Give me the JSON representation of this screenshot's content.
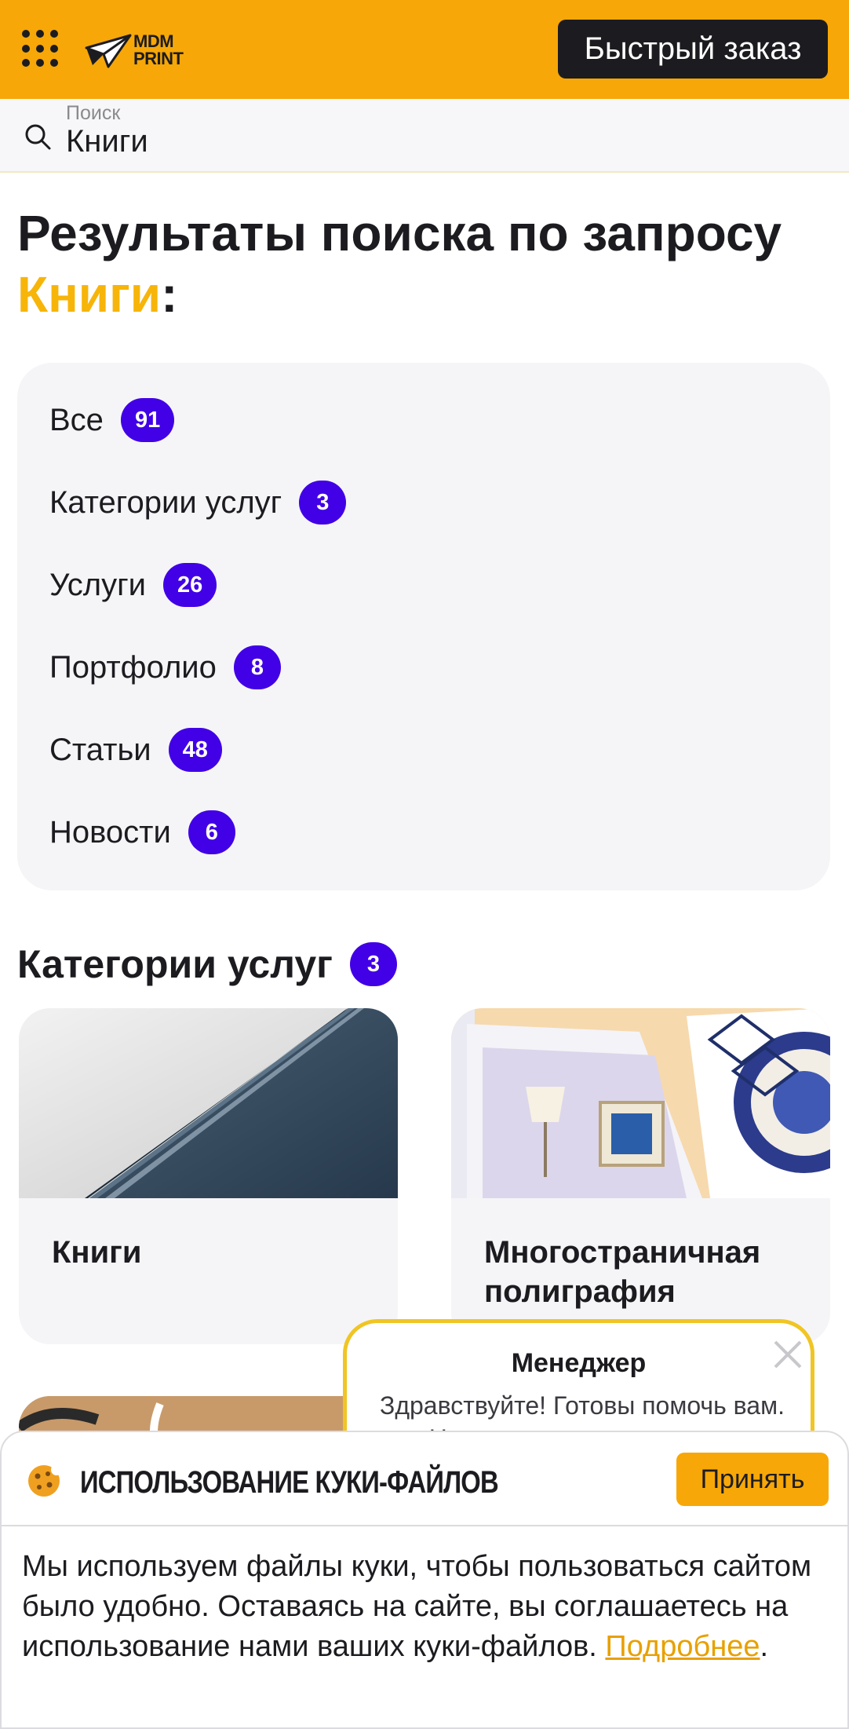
{
  "header": {
    "logo_text_1": "MDM",
    "logo_text_2": "PRINT",
    "quick_order_label": "Быстрый заказ",
    "brand_color": "#f7a707"
  },
  "search": {
    "label": "Поиск",
    "value": "Книги"
  },
  "results": {
    "title_prefix": "Результаты поиска по запросу",
    "query": "Книги",
    "colon": ":"
  },
  "filters": [
    {
      "label": "Все",
      "count": "91"
    },
    {
      "label": "Категории услуг",
      "count": "3"
    },
    {
      "label": "Услуги",
      "count": "26"
    },
    {
      "label": "Портфолио",
      "count": "8"
    },
    {
      "label": "Статьи",
      "count": "48"
    },
    {
      "label": "Новости",
      "count": "6"
    }
  ],
  "section": {
    "title": "Категории услуг",
    "count": "3",
    "cards": [
      {
        "title": "Книги"
      },
      {
        "title": "Многостраничная полиграфия"
      }
    ]
  },
  "manager": {
    "title": "Менеджер",
    "text": "Здравствуйте! Готовы помочь вам. Напишите нам, если у вас"
  },
  "cookie": {
    "title": "Использование куки-файлов",
    "accept_label": "Принять",
    "text": "Мы используем файлы куки, чтобы пользоваться сайтом было удобно. Оставаясь на сайте, вы соглашаетесь на использование нами ваших куки-файлов.",
    "link_label": "Подробнее",
    "trailing": "."
  },
  "colors": {
    "badge": "#4100e6",
    "highlight": "#f7b50a"
  }
}
